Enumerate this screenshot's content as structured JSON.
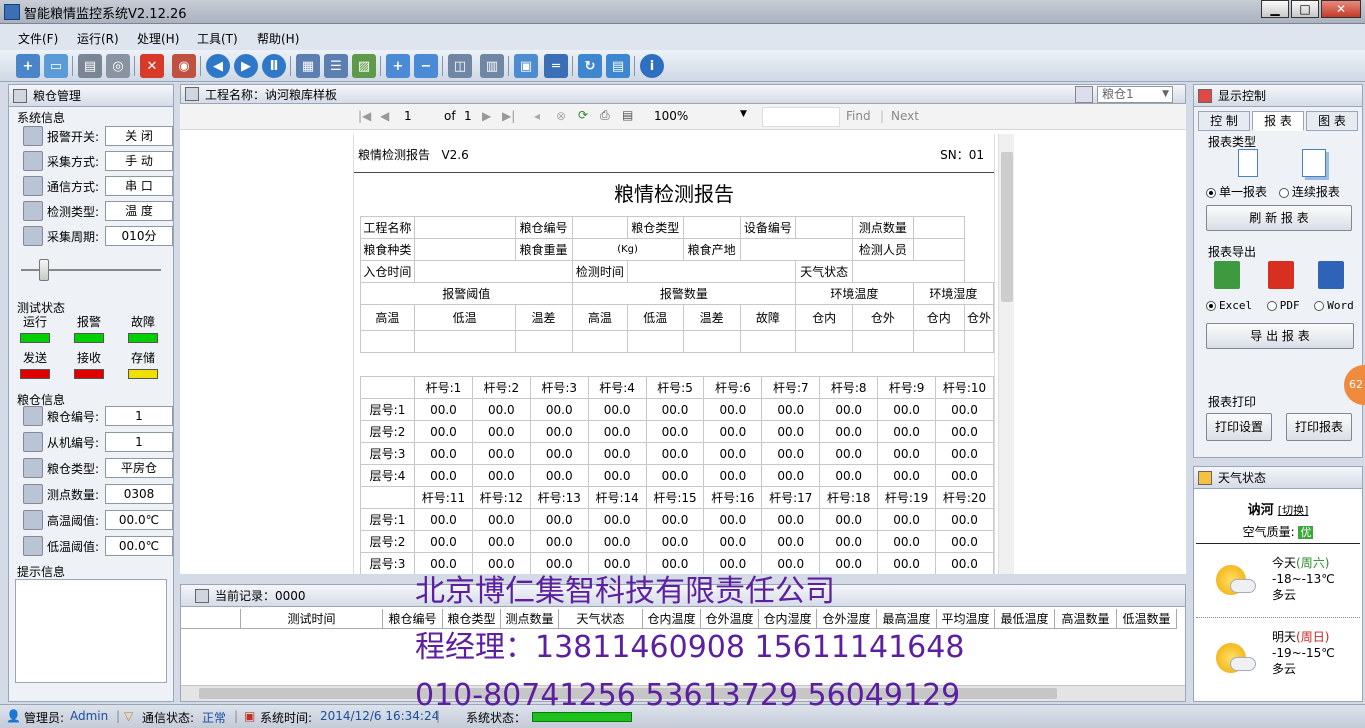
{
  "window": {
    "title": "智能粮情监控系统V2.12.26",
    "minimize": "▁",
    "maximize": "□",
    "close": "✕"
  },
  "menu": [
    "文件(F)",
    "运行(R)",
    "处理(H)",
    "工具(T)",
    "帮助(H)"
  ],
  "left_panel": {
    "title": "粮仓管理",
    "system_info_label": "系统信息",
    "fields": [
      {
        "label": "报警开关:",
        "value": "关  闭",
        "icon": "alarm-switch-icon"
      },
      {
        "label": "采集方式:",
        "value": "手  动",
        "icon": "collect-mode-icon"
      },
      {
        "label": "通信方式:",
        "value": "串  口",
        "icon": "comm-mode-icon"
      },
      {
        "label": "检测类型:",
        "value": "温  度",
        "icon": "detect-type-icon"
      },
      {
        "label": "采集周期:",
        "value": "010分",
        "icon": "clock-icon"
      }
    ],
    "test_status_label": "测试状态",
    "lamps": [
      {
        "label": "运行",
        "color": "#00d000"
      },
      {
        "label": "报警",
        "color": "#00d000"
      },
      {
        "label": "故障",
        "color": "#00d000"
      },
      {
        "label": "发送",
        "color": "#e00000"
      },
      {
        "label": "接收",
        "color": "#e00000"
      },
      {
        "label": "存储",
        "color": "#f0e000"
      }
    ],
    "granary_info_label": "粮仓信息",
    "granary_fields": [
      {
        "label": "粮仓编号:",
        "value": "1",
        "icon": "granary-icon"
      },
      {
        "label": "从机编号:",
        "value": "1",
        "icon": "slave-icon"
      },
      {
        "label": "粮仓类型:",
        "value": "平房仓",
        "icon": "granary-type-icon"
      },
      {
        "label": "测点数量:",
        "value": "0308",
        "icon": "points-icon"
      },
      {
        "label": "高温阈值:",
        "value": "00.0℃",
        "icon": "thermometer-high-icon"
      },
      {
        "label": "低温阈值:",
        "value": "00.0℃",
        "icon": "thermometer-low-icon"
      }
    ],
    "hint_label": "提示信息"
  },
  "report_header": {
    "project_label": "工程名称：讷河粮库样板",
    "granary_select": "粮仓1"
  },
  "viewer": {
    "page": "1",
    "of": "of",
    "total": "1",
    "zoom": "100%",
    "find": "Find",
    "next": "Next"
  },
  "report": {
    "header_left": "粮情检测报告   V2.6",
    "header_right": "SN：01",
    "title": "粮情检测报告",
    "row1": [
      "工程名称",
      "粮仓编号",
      "粮仓类型",
      "设备编号",
      "测点数量"
    ],
    "row2": [
      "粮食种类",
      "粮食重量",
      "(Kg)",
      "粮食产地",
      "检测人员"
    ],
    "row3": [
      "入仓时间",
      "检测时间",
      "天气状态"
    ],
    "groups": [
      "报警阈值",
      "报警数量",
      "环境温度",
      "环境湿度"
    ],
    "sub": [
      "高温",
      "低温",
      "温差",
      "高温",
      "低温",
      "温差",
      "故障",
      "仓内",
      "仓外",
      "仓内",
      "仓外"
    ],
    "poles1": [
      "杆号:1",
      "杆号:2",
      "杆号:3",
      "杆号:4",
      "杆号:5",
      "杆号:6",
      "杆号:7",
      "杆号:8",
      "杆号:9",
      "杆号:10"
    ],
    "poles2": [
      "杆号:11",
      "杆号:12",
      "杆号:13",
      "杆号:14",
      "杆号:15",
      "杆号:16",
      "杆号:17",
      "杆号:18",
      "杆号:19",
      "杆号:20"
    ],
    "layers1": [
      "层号:1",
      "层号:2",
      "层号:3",
      "层号:4"
    ],
    "layers2": [
      "层号:1",
      "层号:2",
      "层号:3"
    ],
    "cell": "00.0"
  },
  "records": {
    "label": "当前记录：0000",
    "columns": [
      "",
      "测试时间",
      "粮仓编号",
      "粮仓类型",
      "测点数量",
      "天气状态",
      "仓内温度",
      "仓外温度",
      "仓内湿度",
      "仓外湿度",
      "最高温度",
      "平均温度",
      "最低温度",
      "高温数量",
      "低温数量"
    ]
  },
  "right_panel": {
    "title": "显示控制",
    "tabs": [
      "控 制",
      "报 表",
      "图 表"
    ],
    "report_type_label": "报表类型",
    "single": "单一报表",
    "continuous": "连续报表",
    "refresh": "刷 新 报 表",
    "export_label": "报表导出",
    "excel": "Excel",
    "pdf": "PDF",
    "word": "Word",
    "export_btn": "导 出 报 表",
    "print_label": "报表打印",
    "print_setup": "打印设置",
    "print_report": "打印报表",
    "badge": "62"
  },
  "weather": {
    "title": "天气状态",
    "city": "讷河",
    "switch": "[切换]",
    "aq_label": "空气质量:",
    "aq_value": "优",
    "today": "今天",
    "today_day": "(周六)",
    "today_temp": "-18~-13℃",
    "today_desc": "多云",
    "tomorrow": "明天",
    "tomorrow_day": "(周日)",
    "tomorrow_temp": "-19~-15℃",
    "tomorrow_desc": "多云"
  },
  "status": {
    "admin_label": "管理员:",
    "admin": "Admin",
    "comm_label": "通信状态:",
    "comm": "正常",
    "time_label": "系统时间:",
    "time": "2014/12/6 16:34:24",
    "sys_label": "系统状态："
  },
  "overlay": {
    "company": "北京博仁集智科技有限责任公司",
    "manager": "程经理：13811460908 15611141648",
    "phones": "010-80741256 53613729 56049129"
  }
}
